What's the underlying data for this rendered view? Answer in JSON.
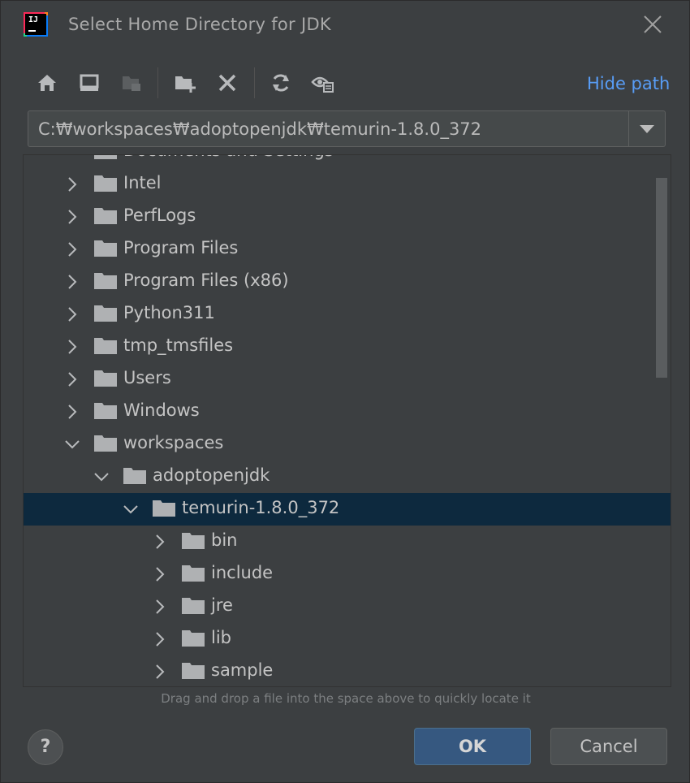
{
  "window": {
    "title": "Select Home Directory for JDK",
    "app_icon_text": "IJ"
  },
  "toolbar": {
    "buttons": [
      "home-icon",
      "desktop-icon",
      "project-icon",
      "new-folder-icon",
      "delete-icon",
      "refresh-icon",
      "show-hidden-icon"
    ],
    "hide_path_label": "Hide path"
  },
  "path": {
    "value": "C:₩workspaces₩adoptopenjdk₩temurin-1.8.0_372"
  },
  "tree": {
    "rows": [
      {
        "label": "Documents and Settings",
        "depth": 1,
        "expanded": false,
        "partial": true
      },
      {
        "label": "Intel",
        "depth": 1,
        "expanded": false
      },
      {
        "label": "PerfLogs",
        "depth": 1,
        "expanded": false
      },
      {
        "label": "Program Files",
        "depth": 1,
        "expanded": false
      },
      {
        "label": "Program Files (x86)",
        "depth": 1,
        "expanded": false
      },
      {
        "label": "Python311",
        "depth": 1,
        "expanded": false
      },
      {
        "label": "tmp_tmsfiles",
        "depth": 1,
        "expanded": false
      },
      {
        "label": "Users",
        "depth": 1,
        "expanded": false
      },
      {
        "label": "Windows",
        "depth": 1,
        "expanded": false
      },
      {
        "label": "workspaces",
        "depth": 1,
        "expanded": true
      },
      {
        "label": "adoptopenjdk",
        "depth": 2,
        "expanded": true
      },
      {
        "label": "temurin-1.8.0_372",
        "depth": 3,
        "expanded": true,
        "selected": true
      },
      {
        "label": "bin",
        "depth": 4,
        "expanded": false
      },
      {
        "label": "include",
        "depth": 4,
        "expanded": false
      },
      {
        "label": "jre",
        "depth": 4,
        "expanded": false
      },
      {
        "label": "lib",
        "depth": 4,
        "expanded": false
      },
      {
        "label": "sample",
        "depth": 4,
        "expanded": false
      }
    ]
  },
  "hint": "Drag and drop a file into the space above to quickly locate it",
  "buttons": {
    "help": "?",
    "ok": "OK",
    "cancel": "Cancel"
  },
  "colors": {
    "background": "#3c3f41",
    "selection": "#0d293e",
    "link": "#589df6",
    "primary_button": "#365880"
  }
}
